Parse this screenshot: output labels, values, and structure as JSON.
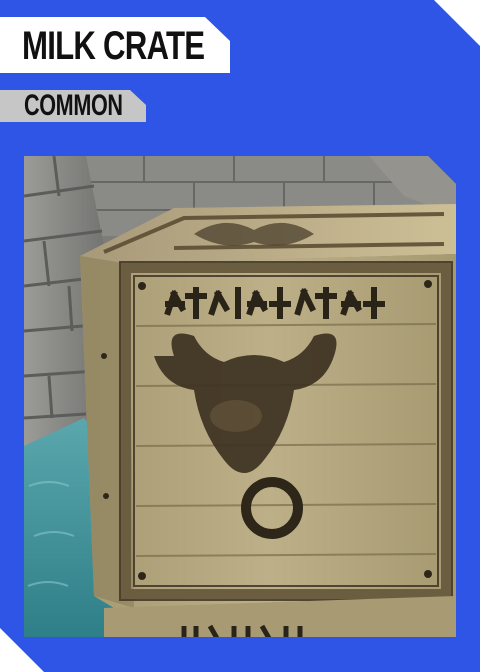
{
  "item": {
    "name": "MILK CRATE",
    "rarity": "COMMON"
  },
  "colors": {
    "background": "#2f55e6",
    "title_plate": "#ffffff",
    "rarity_plate": "#c6c6c6",
    "text": "#111111"
  },
  "art": {
    "subject": "wooden crate with bull-head emblem and glyph inscription"
  }
}
